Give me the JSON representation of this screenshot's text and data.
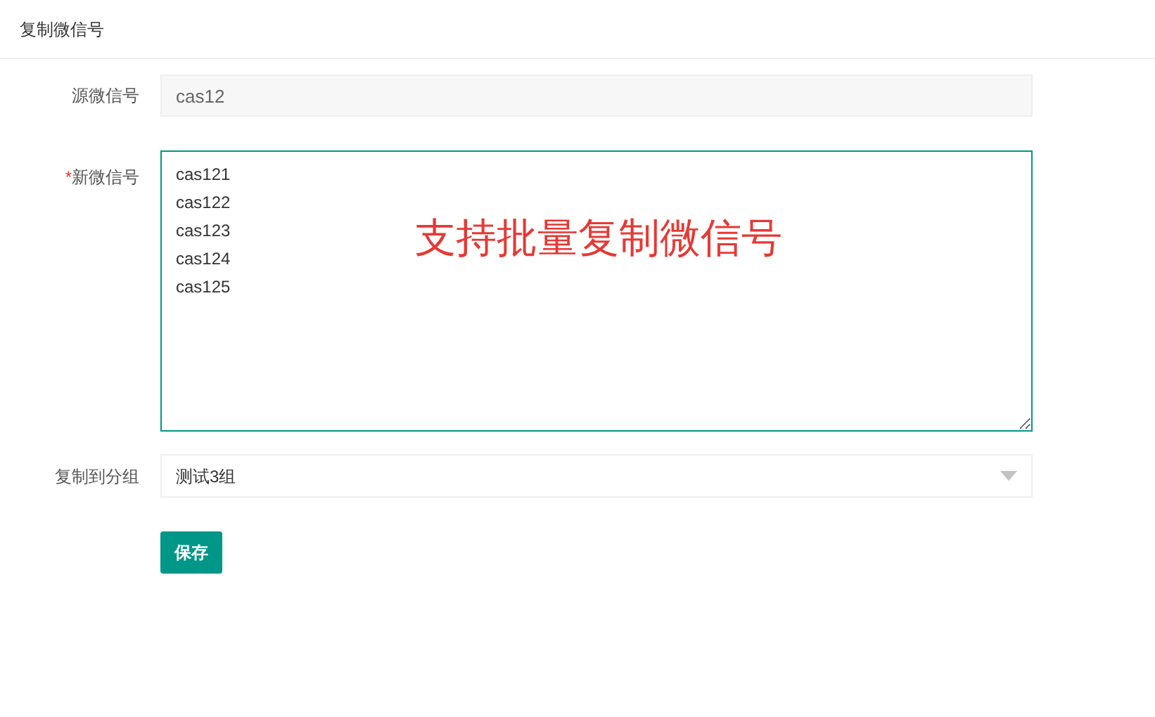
{
  "header": {
    "title": "复制微信号"
  },
  "form": {
    "source": {
      "label": "源微信号",
      "value": "cas12",
      "disabled": true
    },
    "target": {
      "label": "新微信号",
      "required_mark": "*",
      "lines": [
        "cas121",
        "cas122",
        "cas123",
        "cas124",
        "cas125"
      ]
    },
    "group": {
      "label": "复制到分组",
      "value": "测试3组"
    },
    "submit": "保存"
  },
  "annotation": "支持批量复制微信号"
}
